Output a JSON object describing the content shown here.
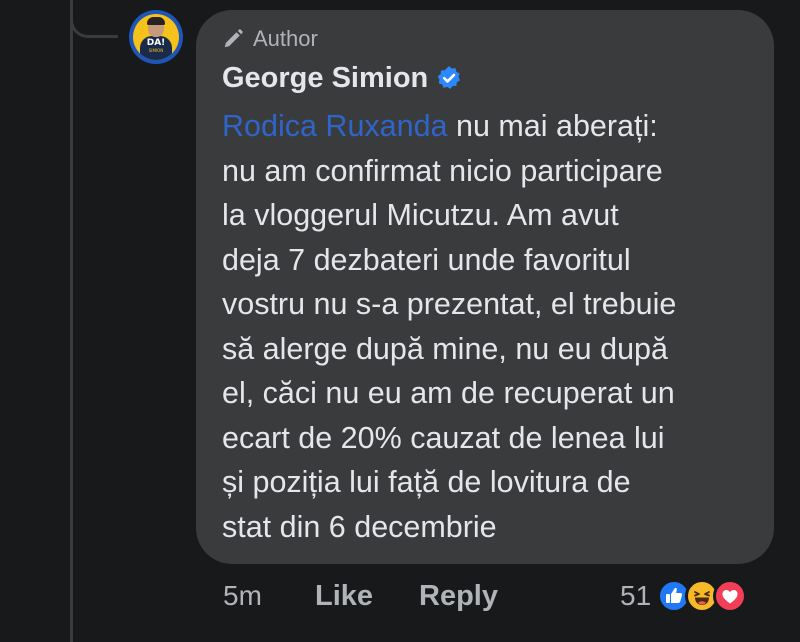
{
  "comment": {
    "badge": "Author",
    "author_name": "George Simion",
    "mention": "Rodica Ruxanda",
    "text": " nu mai aberați:\nnu am confirmat nicio participare\nla vloggerul Micutzu. Am avut\ndeja 7 dezbateri unde favoritul\nvostru nu s-a prezentat, el trebuie\nsă alerge după mine, nu eu după\nel, căci nu eu am de recuperat un\necart de 20% cauzat de lenea lui\nși poziția lui față de lovitura de\nstat din 6 decembrie",
    "avatar": {
      "text": "DA!",
      "subtext": "SIMION"
    }
  },
  "actions": {
    "time": "5m",
    "like_label": "Like",
    "reply_label": "Reply"
  },
  "reactions": {
    "count": "51",
    "types": [
      "like-icon",
      "haha-icon",
      "love-icon"
    ]
  },
  "colors": {
    "background": "#18191a",
    "bubble": "#3a3b3c",
    "text": "#e4e6eb",
    "secondary_text": "#b0b3b8",
    "mention": "#2f64c9",
    "verified": "#2d88ff",
    "like": "#2078f4",
    "haha": "#f7b928",
    "love": "#f33e58"
  }
}
